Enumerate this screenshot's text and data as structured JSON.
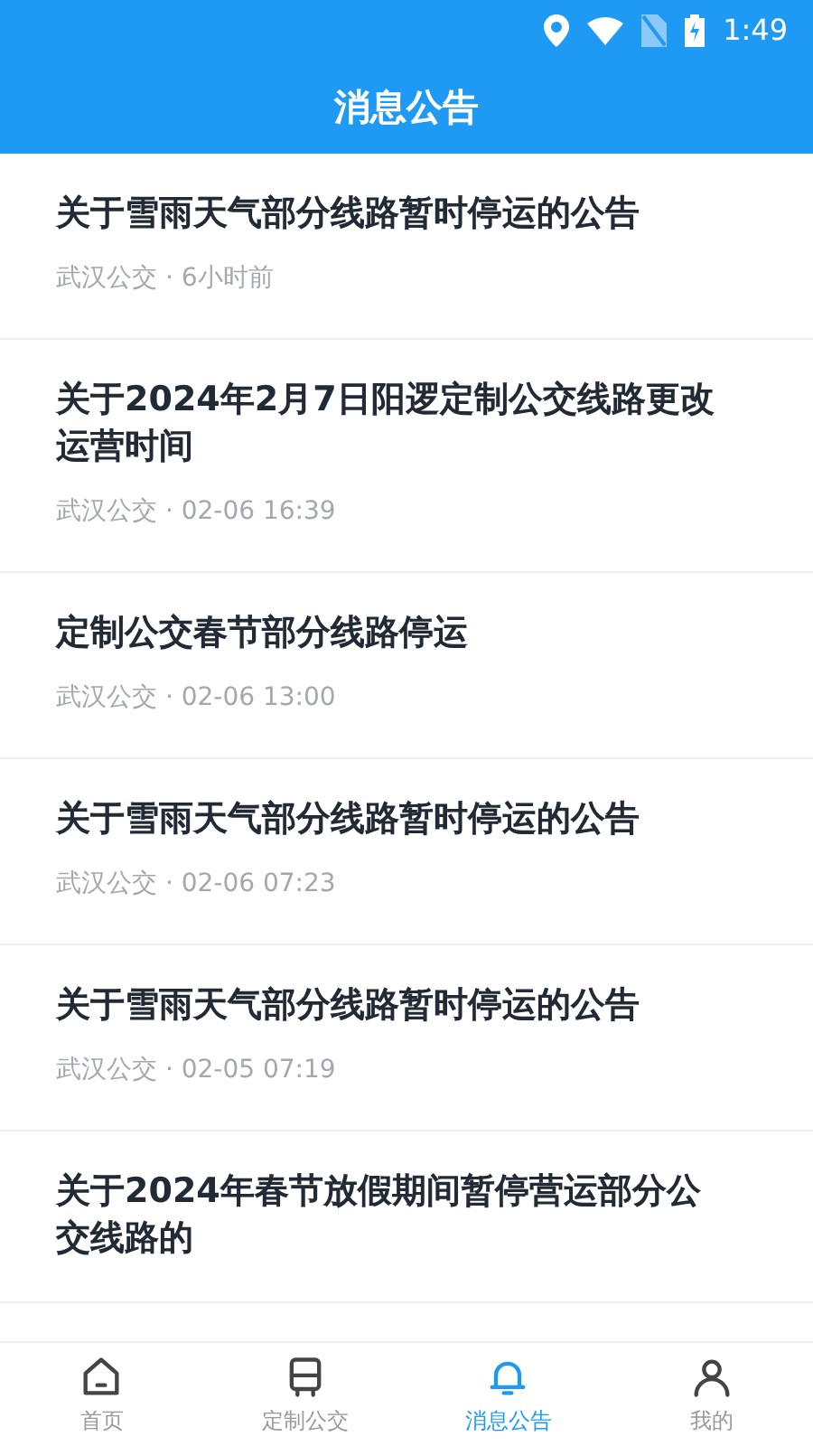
{
  "status_bar": {
    "time": "1:49"
  },
  "header": {
    "title": "消息公告"
  },
  "notices": [
    {
      "title": "关于雪雨天气部分线路暂时停运的公告",
      "meta": "武汉公交 · 6小时前"
    },
    {
      "title": "关于2024年2月7日阳逻定制公交线路更改运营时间",
      "meta": "武汉公交 · 02-06 16:39"
    },
    {
      "title": "定制公交春节部分线路停运",
      "meta": "武汉公交 · 02-06 13:00"
    },
    {
      "title": "关于雪雨天气部分线路暂时停运的公告",
      "meta": "武汉公交 · 02-06 07:23"
    },
    {
      "title": "关于雪雨天气部分线路暂时停运的公告",
      "meta": "武汉公交 · 02-05 07:19"
    },
    {
      "title": "关于2024年春节放假期间暂停营运部分公交线路的"
    }
  ],
  "tab_bar": [
    {
      "label": "首页",
      "kind": "home",
      "selected": false
    },
    {
      "label": "定制公交",
      "kind": "bus",
      "selected": false
    },
    {
      "label": "消息公告",
      "kind": "notice",
      "selected": true
    },
    {
      "label": "我的",
      "kind": "user",
      "selected": false
    }
  ]
}
